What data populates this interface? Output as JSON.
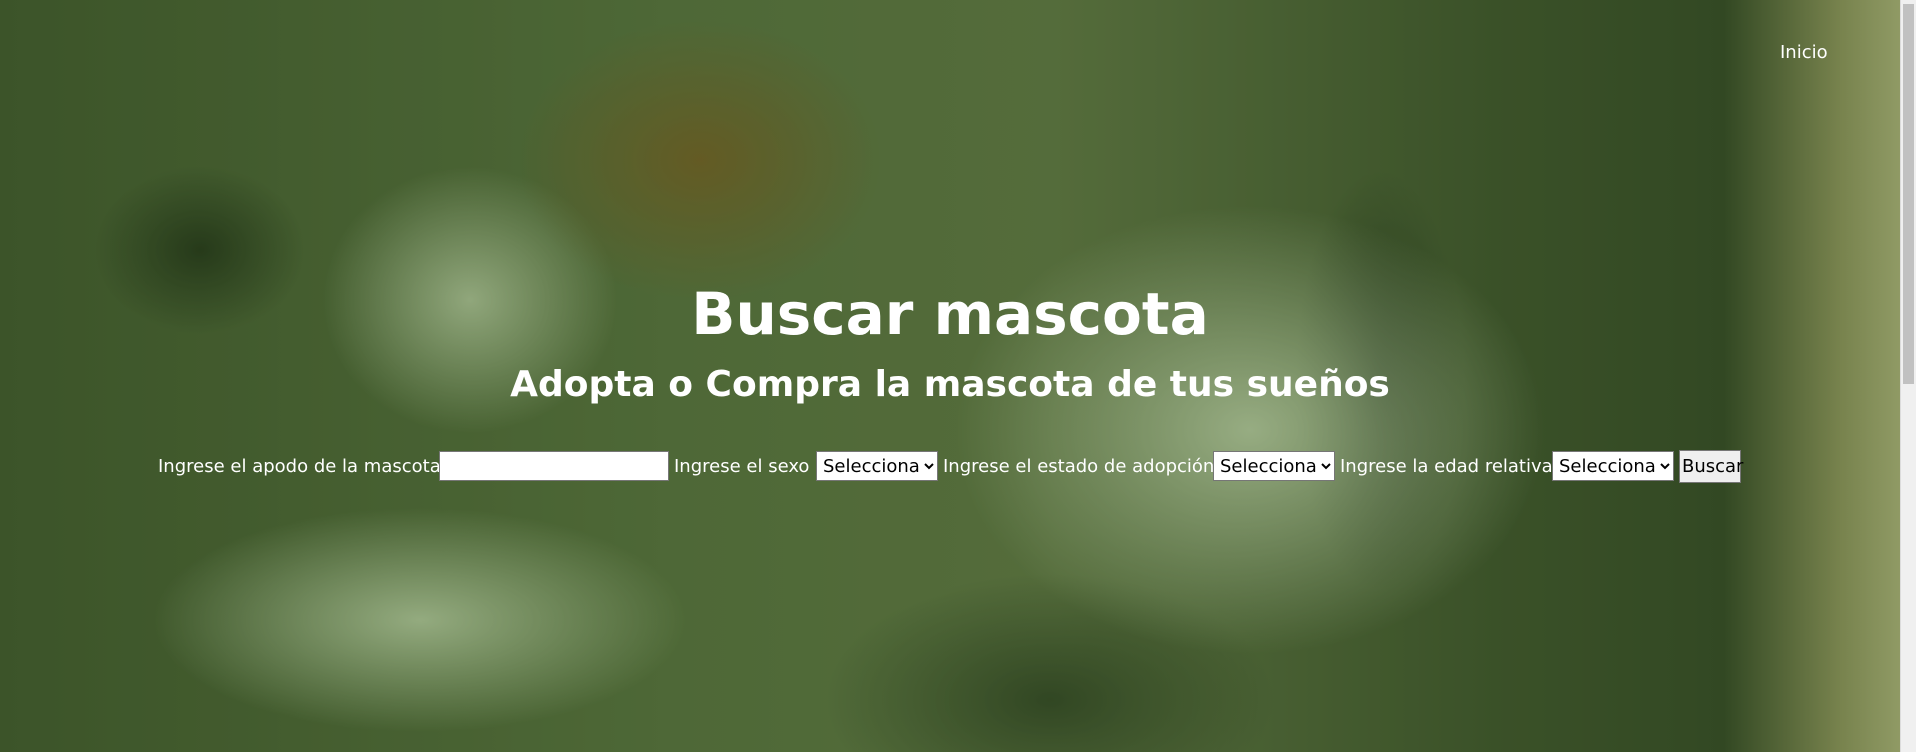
{
  "nav": {
    "inicio_label": "Inicio"
  },
  "hero": {
    "title": "Buscar mascota",
    "subtitle": "Adopta o Compra la mascota de tus sueños"
  },
  "search_form": {
    "nickname_label": "Ingrese el apodo de la mascota",
    "nickname_value": "",
    "sex_label": "Ingrese el sexo",
    "sex_selected": "Selecciona",
    "adoption_label": "Ingrese el estado de adopción",
    "adoption_selected": "Selecciona",
    "age_label": "Ingrese la edad relativa",
    "age_selected": "Selecciona",
    "search_button": "Buscar"
  },
  "colors": {
    "overlay": "#3c6e28",
    "text": "#ffffff"
  }
}
